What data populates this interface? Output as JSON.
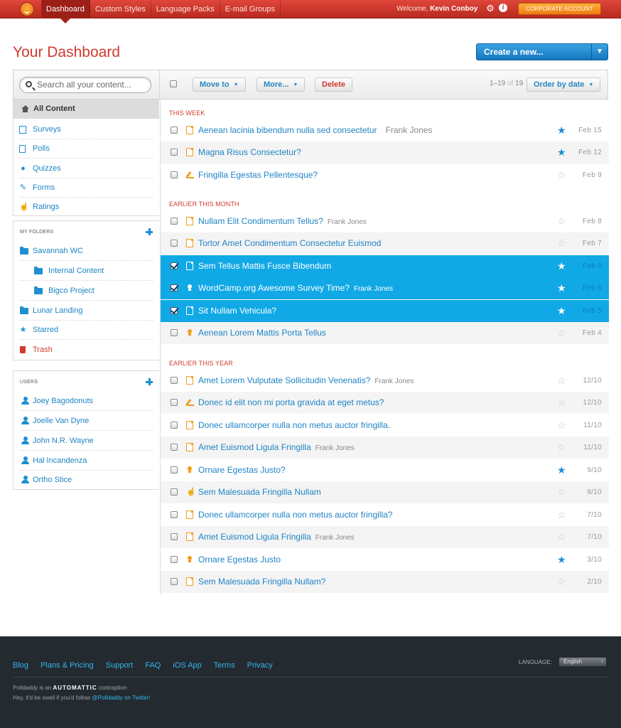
{
  "topbar": {
    "nav": [
      "Dashboard",
      "Custom Styles",
      "Language Packs",
      "E-mail Groups"
    ],
    "welcome_prefix": "Welcome,",
    "user_name": "Kevin Conboy",
    "corporate_label": "CORPORATE ACCOUNT",
    "settings_icon": "gear-icon",
    "info_icon": "info-icon"
  },
  "header": {
    "title": "Your Dashboard",
    "create_label": "Create a new..."
  },
  "toolbar": {
    "search_placeholder": "Search all your content...",
    "move_label": "Move to",
    "more_label": "More...",
    "delete_label": "Delete",
    "pager_range": "1–19",
    "pager_of": "of",
    "pager_total": "19",
    "order_label": "Order by date"
  },
  "sidebar": {
    "all_content": "All Content",
    "types": [
      "Surveys",
      "Polls",
      "Quizzes",
      "Forms",
      "Ratings"
    ],
    "folders_label": "MY FOLDERS",
    "folders": [
      "Savannah WC",
      "Internal Content",
      "Bigco Project",
      "Lunar Landing",
      "Starred",
      "Trash"
    ],
    "users_label": "USERS",
    "users": [
      "Joey Bagodonuts",
      "Joelle Van Dyne",
      "John N.R. Wayne",
      "Hal Incandenza",
      "Ortho Stice"
    ]
  },
  "sections": [
    "THIS WEEK",
    "EARLIER THIS MONTH",
    "EARLIER THIS YEAR"
  ],
  "rows": [
    {
      "title": "Aenean lacinia bibendum nulla sed consectetur",
      "author": "Frank Jones",
      "date": "Feb 15",
      "starred": true,
      "selected": false,
      "type": "survey"
    },
    {
      "title": "Magna Risus Consectetur?",
      "author": "",
      "date": "Feb 12",
      "starred": true,
      "selected": false,
      "type": "poll"
    },
    {
      "title": "Fringilla Egestas Pellentesque?",
      "author": "",
      "date": "Feb 9",
      "starred": false,
      "selected": false,
      "type": "form"
    },
    {
      "title": "Nullam Elit Condimentum Tellus?",
      "author": "Frank Jones",
      "date": "Feb 8",
      "starred": false,
      "selected": false,
      "type": "poll"
    },
    {
      "title": "Tortor Amet Condimentum Consectetur Euismod",
      "author": "",
      "date": "Feb 7",
      "starred": false,
      "selected": false,
      "type": "survey"
    },
    {
      "title": "Sem Tellus Mattis Fusce Bibendum",
      "author": "",
      "date": "Feb 6",
      "starred": true,
      "selected": true,
      "type": "survey"
    },
    {
      "title": "WordCamp.org Awesome Survey Time?",
      "author": "Frank Jones",
      "date": "Feb 6",
      "starred": true,
      "selected": true,
      "type": "quiz"
    },
    {
      "title": "Sit Nullam Vehicula?",
      "author": "",
      "date": "Feb 5",
      "starred": true,
      "selected": true,
      "type": "poll"
    },
    {
      "title": "Aenean Lorem Mattis Porta Tellus",
      "author": "",
      "date": "Feb 4",
      "starred": false,
      "selected": false,
      "type": "quiz"
    },
    {
      "title": "Amet Lorem Vulputate Sollicitudin Venenatis?",
      "author": "Frank Jones",
      "date": "12/10",
      "starred": false,
      "selected": false,
      "type": "poll"
    },
    {
      "title": "Donec id elit non mi porta gravida at eget metus?",
      "author": "",
      "date": "12/10",
      "starred": false,
      "selected": false,
      "type": "form"
    },
    {
      "title": "Donec ullamcorper nulla non metus auctor fringilla.",
      "author": "",
      "date": "11/10",
      "starred": false,
      "selected": false,
      "type": "survey"
    },
    {
      "title": "Amet Euismod Ligula Fringilla",
      "author": "Frank Jones",
      "date": "11/10",
      "starred": false,
      "selected": false,
      "type": "survey"
    },
    {
      "title": "Ornare Egestas Justo?",
      "author": "",
      "date": "9/10",
      "starred": true,
      "selected": false,
      "type": "quiz"
    },
    {
      "title": "Sem Malesuada Fringilla Nullam",
      "author": "",
      "date": "8/10",
      "starred": false,
      "selected": false,
      "type": "rating"
    },
    {
      "title": "Donec ullamcorper nulla non metus auctor fringilla?",
      "author": "",
      "date": "7/10",
      "starred": false,
      "selected": false,
      "type": "poll"
    },
    {
      "title": "Amet Euismod Ligula Fringilla",
      "author": "Frank Jones",
      "date": "7/10",
      "starred": false,
      "selected": false,
      "type": "survey"
    },
    {
      "title": "Ornare Egestas Justo",
      "author": "",
      "date": "3/10",
      "starred": true,
      "selected": false,
      "type": "quiz"
    },
    {
      "title": "Sem Malesuada Fringilla Nullam?",
      "author": "",
      "date": "2/10",
      "starred": false,
      "selected": false,
      "type": "poll"
    }
  ],
  "footer": {
    "links": [
      "Blog",
      "Plans & Pricing",
      "Support",
      "FAQ",
      "iOS App",
      "Terms",
      "Privacy"
    ],
    "language_label": "LANGUAGE:",
    "language_value": "English",
    "line1_prefix": "Polldaddy is an",
    "brand": "AUTOMATTIC",
    "line1_suffix": "contraption",
    "line2_prefix": "Hey, it'd be swell if you'd follow",
    "twitter": "@Polldaddy on Twitter!"
  },
  "colors": {
    "brand_red": "#d13a2e",
    "link_blue": "#1e84c4",
    "selected_row": "#11a8e6",
    "orange": "#f29b1c"
  }
}
